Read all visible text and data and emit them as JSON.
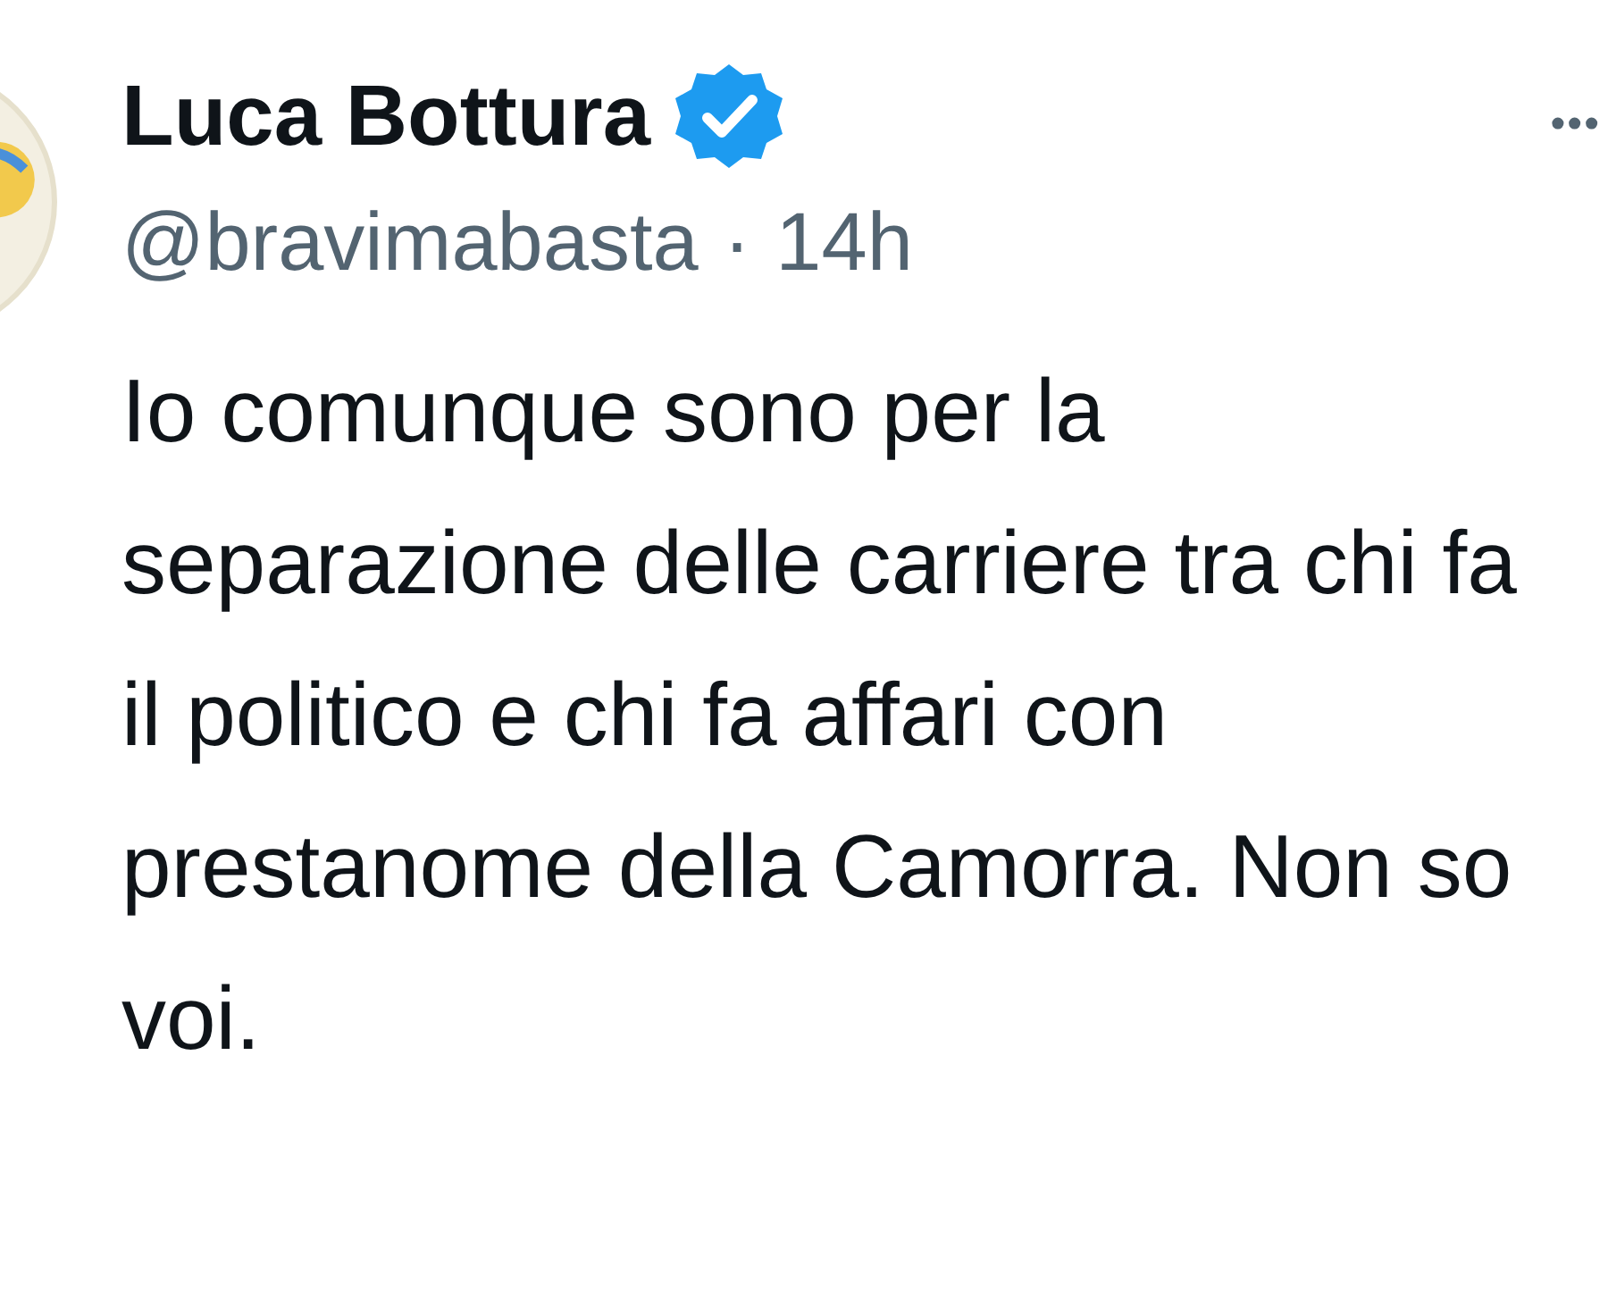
{
  "post": {
    "author": {
      "name": "Luca Bottura",
      "verified": true,
      "handle": "@bravimabasta",
      "separator": "·",
      "time": "14h"
    },
    "menu": "•••",
    "text": "Io comunque sono per la separazione delle carriere tra chi fa il politico e chi fa affari con prestanome della Camorra. Non so voi."
  }
}
